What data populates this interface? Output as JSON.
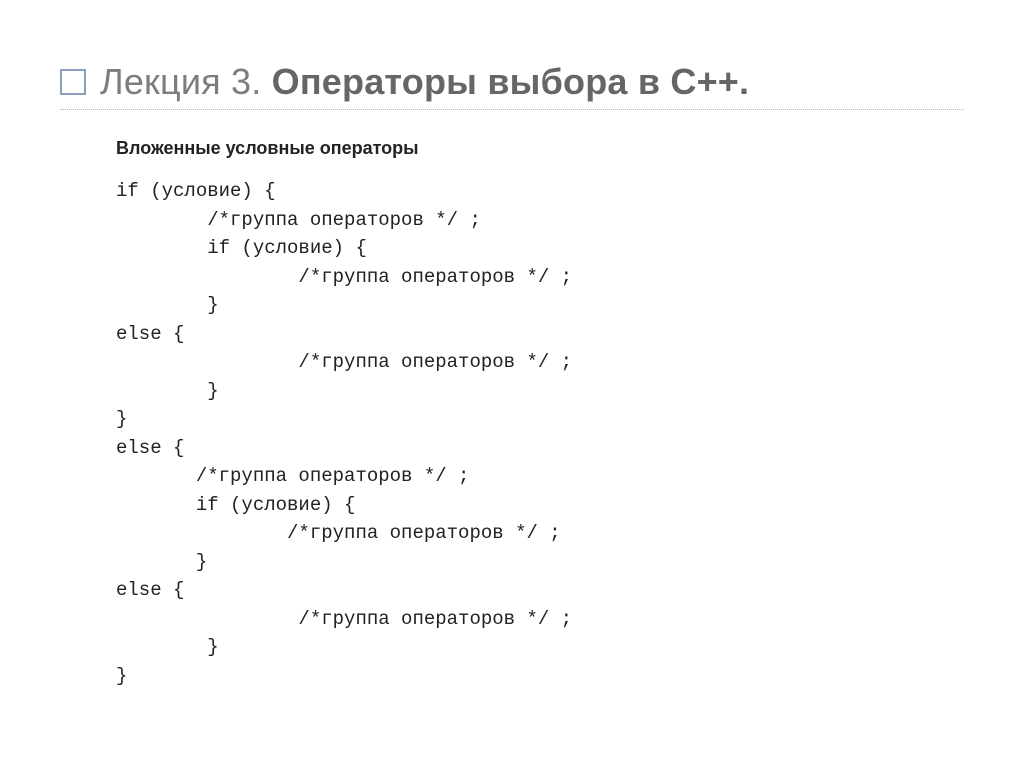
{
  "title": {
    "light": "Лекция 3. ",
    "bold": "Операторы выбора в С++."
  },
  "subheading": "Вложенные условные операторы",
  "code": "if (условие) {\n        /*группа операторов */ ;\n        if (условие) {\n                /*группа операторов */ ;\n        }\nelse {\n                /*группа операторов */ ;\n        }\n}\nelse {\n       /*группа операторов */ ;\n       if (условие) {\n               /*группа операторов */ ;\n       }\nelse {\n                /*группа операторов */ ;\n        }\n}"
}
